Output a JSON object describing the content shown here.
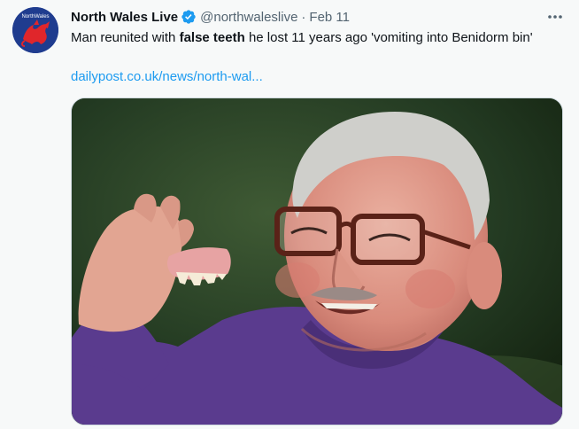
{
  "account": {
    "display_name": "North Wales Live",
    "handle": "@northwaleslive",
    "separator": "·",
    "date": "Feb 11",
    "avatar_text": "NorthWales",
    "verified_icon": "verified-badge-icon",
    "avatar_icon": "red-dragon-logo"
  },
  "tweet": {
    "text_before": "Man reunited with ",
    "text_bold": "false teeth",
    "text_after": " he lost 11 years ago 'vomiting into Benidorm bin'",
    "link": "dailypost.co.uk/news/north-wal..."
  },
  "media": {
    "icon": "photo-man-holding-false-teeth"
  },
  "colors": {
    "accent": "#1d9bf0",
    "background": "#f7f9f9",
    "text": "#0f1419",
    "secondary": "#536471"
  }
}
